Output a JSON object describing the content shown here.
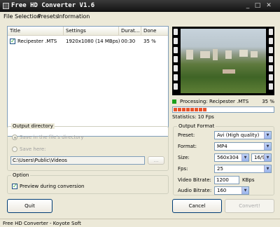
{
  "window": {
    "title": "Free HD Converter V1.6"
  },
  "titlebar_buttons": {
    "minimize": "_",
    "maximize": "□",
    "close": "✕"
  },
  "menu": [
    "File",
    "Selection",
    "Presets",
    "Information"
  ],
  "file_list": {
    "columns": [
      "Title",
      "Settings",
      "Durat...",
      "Done"
    ],
    "rows": [
      {
        "checked": true,
        "title": "Recipester .MTS",
        "settings": "1920x1080 (14 MBps)",
        "duration": "00:30",
        "done": "35 %"
      }
    ]
  },
  "processing": {
    "text": "Processing: Recipester .MTS",
    "percent_text": "35 %",
    "progress": 0.35,
    "statistics": "Statistics: 10 Fps"
  },
  "output_directory": {
    "legend": "Output directory",
    "option_same": "Save in the file's directory",
    "option_here": "Save here:",
    "path": "C:\\Users\\Public\\Videos",
    "browse_label": "..."
  },
  "option_group": {
    "legend": "Option",
    "preview_label": "Preview during conversion",
    "preview_checked": true
  },
  "output_format": {
    "legend": "Output Format",
    "preset_label": "Preset:",
    "preset_value": "Avi (High quality)",
    "format_label": "Format:",
    "format_value": "MP4",
    "size_label": "Size:",
    "size_value": "560x304",
    "aspect_value": "16/9",
    "fps_label": "Fps:",
    "fps_value": "25",
    "video_bitrate_label": "Video Bitrate:",
    "video_bitrate_value": "1200",
    "video_bitrate_unit": "KBps",
    "audio_bitrate_label": "Audio Bitrate:",
    "audio_bitrate_value": "160"
  },
  "buttons": {
    "quit": "Quit",
    "cancel": "Cancel",
    "convert": "Convert!"
  },
  "status_bar": "Free HD Converter - Koyote Soft",
  "colors": {
    "progress": "#e8542b",
    "processing_dot": "#1ca01c",
    "titlebar": "#1a1a1a"
  },
  "icons": {
    "app": "app-icon",
    "dropdown": "chevron-down-icon",
    "checkbox": "check-icon"
  }
}
